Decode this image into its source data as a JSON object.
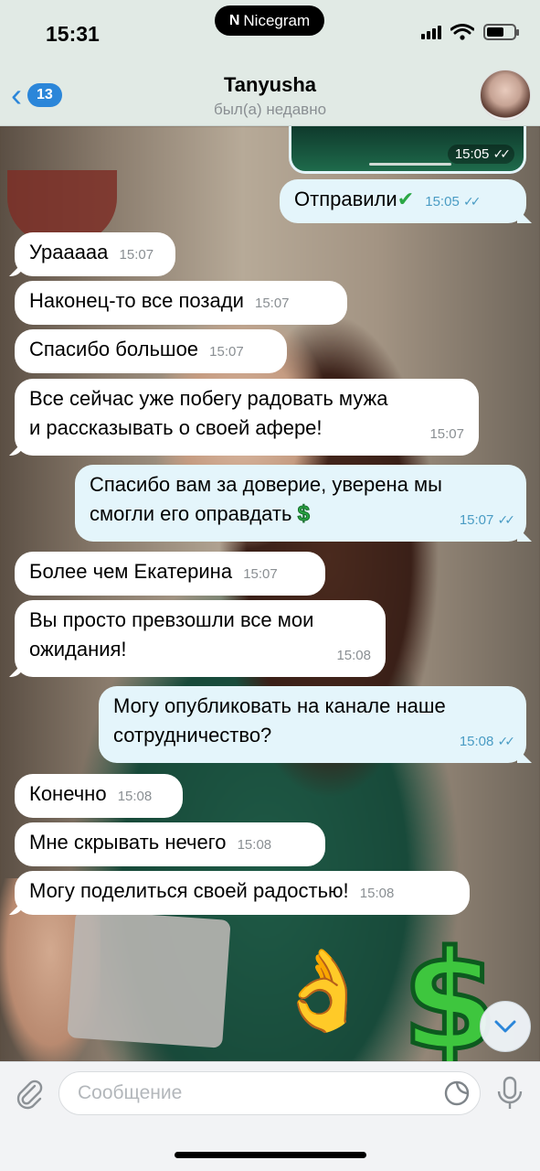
{
  "status_bar": {
    "time": "15:31",
    "island_label": "Nicegram"
  },
  "header": {
    "back_count": "13",
    "contact_name": "Tanyusha",
    "contact_status": "был(а) недавно"
  },
  "media_message": {
    "time": "15:05"
  },
  "messages": [
    {
      "dir": "out",
      "text": "Отправили",
      "emoji": "check",
      "time": "15:05"
    },
    {
      "dir": "in",
      "text": "Урааааа",
      "time": "15:07"
    },
    {
      "dir": "in",
      "text": "Наконец-то все позади",
      "time": "15:07"
    },
    {
      "dir": "in",
      "text": "Спасибо большое",
      "time": "15:07"
    },
    {
      "dir": "in",
      "text_lines": [
        "Все сейчас уже побегу радовать мужа",
        "и рассказывать о своей афере!"
      ],
      "time": "15:07"
    },
    {
      "dir": "out",
      "text_lines": [
        "Спасибо вам за доверие, уверена мы",
        "смогли его оправдать"
      ],
      "emoji": "dollar",
      "time": "15:07"
    },
    {
      "dir": "in",
      "text": "Более чем Екатерина",
      "time": "15:07"
    },
    {
      "dir": "in",
      "text_lines": [
        "Вы просто превзошли все мои",
        "ожидания!"
      ],
      "time": "15:08"
    },
    {
      "dir": "out",
      "text_lines": [
        "Могу опубликовать на канале наше",
        "сотрудничество?"
      ],
      "time": "15:08"
    },
    {
      "dir": "in",
      "text": "Конечно",
      "time": "15:08"
    },
    {
      "dir": "in",
      "text": "Мне скрывать нечего",
      "time": "15:08"
    },
    {
      "dir": "in",
      "text": "Могу поделиться своей радостью!",
      "time": "15:08"
    }
  ],
  "stickers": {
    "ok_hand": "👌",
    "dollar": "$"
  },
  "composer": {
    "placeholder": "Сообщение"
  },
  "colors": {
    "accent": "#2b86d9",
    "outgoing_bubble": "#e4f5fb",
    "incoming_bubble": "#ffffff",
    "header_bg": "#e7f0ec"
  }
}
